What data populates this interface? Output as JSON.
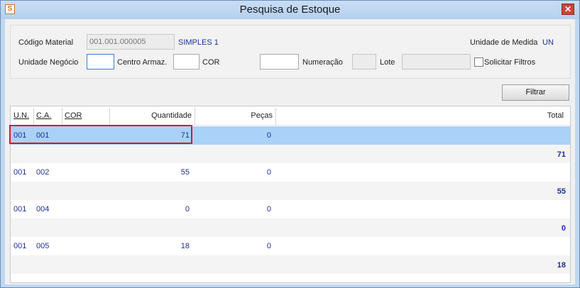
{
  "window": {
    "title": "Pesquisa de Estoque",
    "close": "✕",
    "icon": "S"
  },
  "filters": {
    "codigo_material_label": "Código Material",
    "codigo_material_value": "001.001.000005",
    "material_desc": "SIMPLES 1",
    "unidade_medida_label": "Unidade de Medida",
    "unidade_medida_value": "UN",
    "unidade_negocio_label": "Unidade Negócio",
    "unidade_negocio_value": "",
    "centro_armaz_label": "Centro Armaz.",
    "centro_armaz_value": "",
    "cor_label": "COR",
    "cor_value": "",
    "numeracao_label": "Numeração",
    "numeracao_value": "",
    "lote_label": "Lote",
    "lote_value": "",
    "solicitar_filtros_label": "Solicitar Filtros"
  },
  "buttons": {
    "filtrar": "Filtrar"
  },
  "table": {
    "headers": {
      "un": "U.N.",
      "ca": "C.A.",
      "cor": "COR",
      "quantidade": "Quantidade",
      "pecas": "Peças",
      "total": "Total"
    },
    "rows": [
      {
        "un": "001",
        "ca": "001",
        "cor": "",
        "quantidade": "71",
        "pecas": "0",
        "total": "71"
      },
      {
        "un": "001",
        "ca": "002",
        "cor": "",
        "quantidade": "55",
        "pecas": "0",
        "total": "55"
      },
      {
        "un": "001",
        "ca": "004",
        "cor": "",
        "quantidade": "0",
        "pecas": "0",
        "total": "0"
      },
      {
        "un": "001",
        "ca": "005",
        "cor": "",
        "quantidade": "18",
        "pecas": "0",
        "total": "18"
      }
    ]
  }
}
